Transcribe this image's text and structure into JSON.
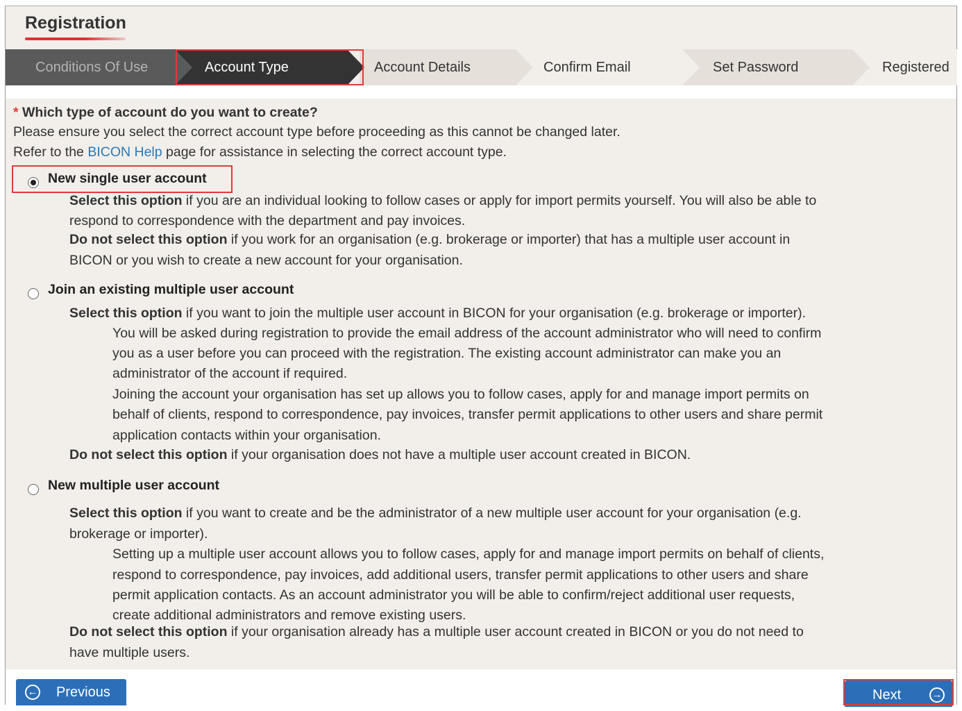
{
  "header": {
    "title": "Registration"
  },
  "steps": [
    {
      "label": "Conditions Of Use",
      "state": "done"
    },
    {
      "label": "Account Type",
      "state": "current"
    },
    {
      "label": "Account Details",
      "state": "todo"
    },
    {
      "label": "Confirm Email",
      "state": "todo"
    },
    {
      "label": "Set Password",
      "state": "todo"
    },
    {
      "label": "Registered",
      "state": "todo"
    }
  ],
  "question": {
    "required_mark": "*",
    "title": "Which type of account do you want to create?",
    "line1": "Please ensure you select the correct account type before proceeding as this cannot be changed later.",
    "line2_pre": "Refer to the ",
    "line2_link": "BICON Help",
    "line2_post": " page for assistance in selecting the correct account type."
  },
  "options": [
    {
      "label": "New single user account",
      "selected": true,
      "select_bold": "Select this option",
      "select_text_1": " if you are an individual looking to follow cases or apply for import permits yourself. You will also be able to",
      "select_text_2": "respond to correspondence with the department and pay invoices.",
      "donot_bold": "Do not select this option",
      "donot_text_1": " if you work for an organisation (e.g. brokerage or importer) that has a multiple user account in",
      "donot_text_2": "BICON or you wish to create a new account for your organisation."
    },
    {
      "label": "Join an existing multiple user account",
      "selected": false,
      "select_bold": "Select this option",
      "select_text_1": " if you want to join the multiple user account in BICON for your organisation (e.g. brokerage or importer).",
      "sub_1": "You will be asked during registration to provide the email address of the account administrator who will need to confirm",
      "sub_2": "you as a user before you can proceed with the registration. The existing account administrator can make you an",
      "sub_3": "administrator of the account if required.",
      "sub_4": "Joining the account your organisation has set up allows you to follow cases, apply for and manage import permits on",
      "sub_5": "behalf of clients, respond to correspondence, pay invoices, transfer permit applications to other users and share permit",
      "sub_6": "application contacts within your organisation.",
      "donot_bold": "Do not select this option",
      "donot_text_1": " if your organisation does not have a multiple user account created in BICON."
    },
    {
      "label": "New multiple user account",
      "selected": false,
      "select_bold": "Select this option",
      "select_text_1": " if you want to create and be the administrator of a new multiple user account for your organisation (e.g.",
      "select_text_2": "brokerage or importer).",
      "sub_1": "Setting up a multiple user account allows you to follow cases, apply for and manage import permits on behalf of clients,",
      "sub_2": "respond to correspondence, pay invoices, add additional users, transfer permit applications to other users and share",
      "sub_3": "permit application contacts. As an account administrator you will be able to confirm/reject additional user requests,",
      "sub_4": "create additional administrators and remove existing users.",
      "donot_bold": "Do not select this option",
      "donot_text_1": " if your organisation already has a multiple user account created in BICON or you do not need to",
      "donot_text_2": "have multiple users."
    }
  ],
  "buttons": {
    "previous": "Previous",
    "next": "Next"
  },
  "colors": {
    "accent": "#2c6fb8",
    "highlight": "#e23a3a",
    "step_done": "#5a5a5a",
    "step_current": "#333333",
    "step_todo": "#e6e0da"
  }
}
